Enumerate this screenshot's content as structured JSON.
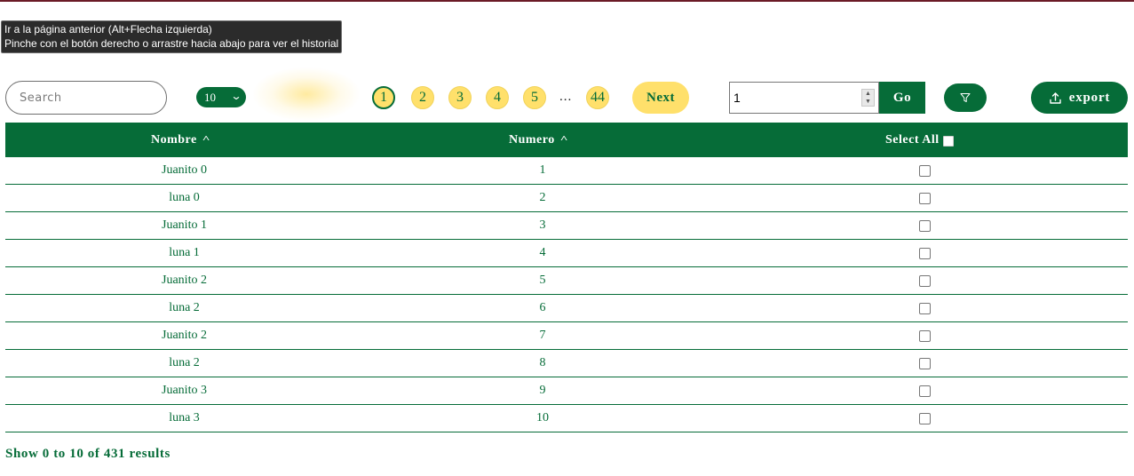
{
  "tooltip": {
    "line1": "Ir a la página anterior (Alt+Flecha izquierda)",
    "line2": "Pinche con el botón derecho o arrastre hacia abajo para ver el historial"
  },
  "toolbar": {
    "search_placeholder": "Search",
    "page_size": "10",
    "pages": [
      "1",
      "2",
      "3",
      "4",
      "5"
    ],
    "active_page": "1",
    "ellipsis": "...",
    "last_page": "44",
    "next_label": "Next",
    "goto_value": "1",
    "go_label": "Go",
    "export_label": "export"
  },
  "table": {
    "headers": {
      "nombre": "Nombre",
      "numero": "Numero",
      "select_all": "Select All"
    },
    "rows": [
      {
        "nombre": "Juanito 0",
        "numero": "1",
        "checked": false
      },
      {
        "nombre": "luna 0",
        "numero": "2",
        "checked": false
      },
      {
        "nombre": "Juanito 1",
        "numero": "3",
        "checked": false
      },
      {
        "nombre": "luna 1",
        "numero": "4",
        "checked": false
      },
      {
        "nombre": "Juanito 2",
        "numero": "5",
        "checked": false
      },
      {
        "nombre": "luna 2",
        "numero": "6",
        "checked": false
      },
      {
        "nombre": "Juanito 2",
        "numero": "7",
        "checked": false
      },
      {
        "nombre": "luna 2",
        "numero": "8",
        "checked": false
      },
      {
        "nombre": "Juanito 3",
        "numero": "9",
        "checked": false
      },
      {
        "nombre": "luna 3",
        "numero": "10",
        "checked": false
      }
    ]
  },
  "summary": "Show 0 to 10 of 431 results",
  "colors": {
    "primary_green": "#066c38",
    "accent_yellow": "#ffe06b",
    "top_border": "#6b1b26"
  },
  "icons": {
    "page_size_chevron": "chevron-down-icon",
    "sort": "caret-up-icon",
    "filter": "filter-icon",
    "export": "upload-icon"
  }
}
